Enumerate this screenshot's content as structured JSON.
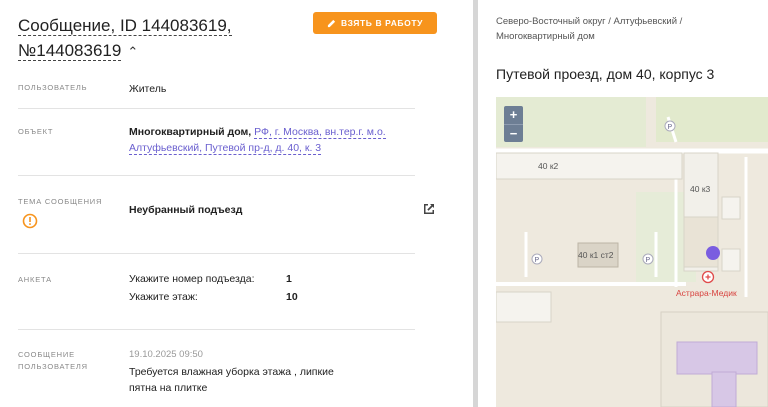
{
  "header": {
    "title": "Сообщение, ID 144083619, №144083619",
    "take_button": "ВЗЯТЬ В РАБОТУ"
  },
  "fields": {
    "user_label": "ПОЛЬЗОВАТЕЛЬ",
    "user_value": "Житель",
    "object_label": "ОБЪЕКТ",
    "object_type": "Многоквартирный дом,",
    "object_address_line1": "РФ, г. Москва, вн.тер.г. м.о.",
    "object_address_line2": "Алтуфьевский, Путевой пр-д, д. 40, к. 3",
    "topic_label": "ТЕМА СООБЩЕНИЯ",
    "topic_value": "Неубранный подъезд",
    "survey_label": "АНКЕТА",
    "survey": [
      {
        "q": "Укажите номер подъезда:",
        "a": "1"
      },
      {
        "q": "Укажите этаж:",
        "a": "10"
      }
    ],
    "message_label_1": "СООБЩЕНИЕ",
    "message_label_2": "ПОЛЬЗОВАТЕЛЯ",
    "message_date": "19.10.2025 09:50",
    "message_text_1": "Требуется влажная уборка этажа , липкие",
    "message_text_2": "пятна на плитке"
  },
  "right": {
    "breadcrumb_1": "Северо-Восточный округ / Алтуфьевский /",
    "breadcrumb_2": "Многоквартирный дом",
    "address_title": "Путевой проезд, дом 40, корпус 3"
  },
  "map": {
    "zoom_in": "+",
    "zoom_out": "−",
    "building_1": "40 к2",
    "building_2": "40 к3",
    "building_3": "40 к1 ст2",
    "poi": "Астрара-Медик",
    "parking": "P",
    "marker_color": "#7a5de0"
  }
}
